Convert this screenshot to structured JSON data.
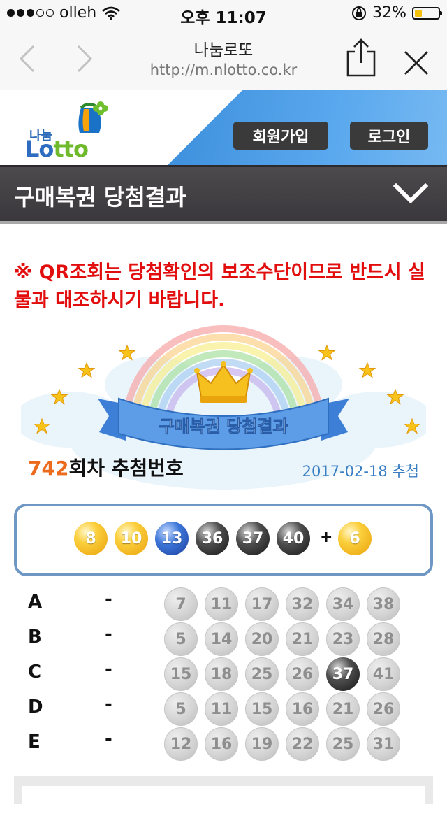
{
  "status_bar": {
    "carrier": "olleh",
    "time": "오후 11:07",
    "battery": "32%",
    "battery_level": 0.32
  },
  "browser": {
    "title": "나눔로또",
    "url": "http://m.nlotto.co.kr"
  },
  "header": {
    "logo_small": "나눔",
    "logo_big_main": "Lo",
    "logo_big_tail": "tto",
    "join_label": "회원가입",
    "login_label": "로그인"
  },
  "section": {
    "title": "구매복권 당첨결과"
  },
  "warning": "※ QR조회는 당첨확인의 보조수단이므로 반드시 실물과 대조하시기 바랍니다.",
  "banner": {
    "ribbon_text": "구매복권 당첨결과",
    "round_number": "742",
    "round_suffix": "회차 추첨번호",
    "draw_date": "2017-02-18 추첨"
  },
  "winning": {
    "numbers": [
      {
        "value": "8",
        "color": "yellow"
      },
      {
        "value": "10",
        "color": "yellow"
      },
      {
        "value": "13",
        "color": "blue"
      },
      {
        "value": "36",
        "color": "black"
      },
      {
        "value": "37",
        "color": "black"
      },
      {
        "value": "40",
        "color": "black"
      }
    ],
    "plus": "+",
    "bonus": {
      "value": "6",
      "color": "yellow"
    }
  },
  "picks": [
    {
      "label": "A",
      "dash": "-",
      "numbers": [
        "7",
        "11",
        "17",
        "32",
        "34",
        "38"
      ],
      "matched": []
    },
    {
      "label": "B",
      "dash": "-",
      "numbers": [
        "5",
        "14",
        "20",
        "21",
        "23",
        "28"
      ],
      "matched": []
    },
    {
      "label": "C",
      "dash": "-",
      "numbers": [
        "15",
        "18",
        "25",
        "26",
        "37",
        "41"
      ],
      "matched": [
        "37"
      ]
    },
    {
      "label": "D",
      "dash": "-",
      "numbers": [
        "5",
        "11",
        "15",
        "16",
        "21",
        "26"
      ],
      "matched": []
    },
    {
      "label": "E",
      "dash": "-",
      "numbers": [
        "12",
        "16",
        "19",
        "22",
        "25",
        "31"
      ],
      "matched": []
    }
  ],
  "colors": {
    "warning": "#e20e0e",
    "round_number": "#ec6a1c",
    "header_blue": "#4a9be6",
    "section_bar": "#433f44"
  }
}
